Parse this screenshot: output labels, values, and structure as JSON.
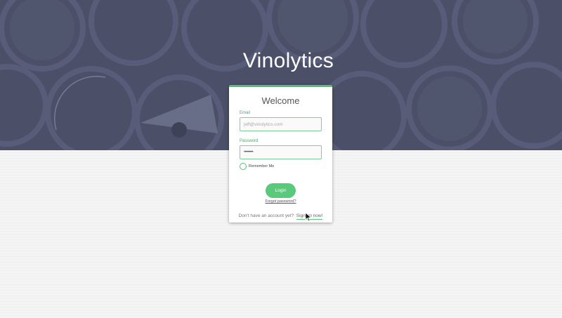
{
  "app": {
    "title": "Vinolytics"
  },
  "login_card": {
    "heading": "Welcome",
    "email": {
      "label": "Email",
      "placeholder": "jeff@vinolytics.com",
      "value": ""
    },
    "password": {
      "label": "Password",
      "value": "••••••••••"
    },
    "remember_me": {
      "label": "Remember Me",
      "checked": false
    },
    "login_button": "Login",
    "forgot_link": "Forgot password?",
    "signup": {
      "prompt": "Don't have an account yet?",
      "link": "Sign up now!"
    }
  },
  "colors": {
    "hero_background": "#4b5068",
    "accent_green": "#52c27a",
    "page_background": "#f3f3f3"
  }
}
